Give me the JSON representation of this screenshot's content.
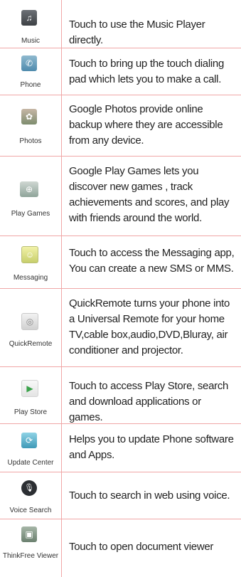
{
  "rows": [
    {
      "icon": "music-icon",
      "label": "Music",
      "desc": "Touch to use the Music Player directly."
    },
    {
      "icon": "phone-icon",
      "label": "Phone",
      "desc": "Touch to bring up the touch dialing pad which lets you to make a call."
    },
    {
      "icon": "photos-icon",
      "label": "Photos",
      "desc": "Google Photos provide online backup where they are accessible from any device."
    },
    {
      "icon": "play-games-icon",
      "label": "Play Games",
      "desc": "Google Play Games lets you discover new games , track achievements and scores, and play with friends around the world."
    },
    {
      "icon": "messaging-icon",
      "label": "Messaging",
      "desc": "Touch to access the Messaging app, You can create a new SMS or MMS."
    },
    {
      "icon": "quickremote-icon",
      "label": "QuickRemote",
      "desc": "QuickRemote turns your phone into a Universal Remote for your home TV,cable box,audio,DVD,Bluray, air conditioner and projector."
    },
    {
      "icon": "play-store-icon",
      "label": "Play Store",
      "desc": "Touch to access Play Store, search and download applications or games."
    },
    {
      "icon": "update-center-icon",
      "label": "Update Center",
      "desc": "Helps you to update Phone software and  Apps."
    },
    {
      "icon": "voice-search-icon",
      "label": "Voice Search",
      "desc": "Touch to search in web using voice."
    },
    {
      "icon": "thinkfree-viewer-icon",
      "label": "ThinkFree Viewer",
      "desc": "Touch to open document viewer"
    }
  ]
}
